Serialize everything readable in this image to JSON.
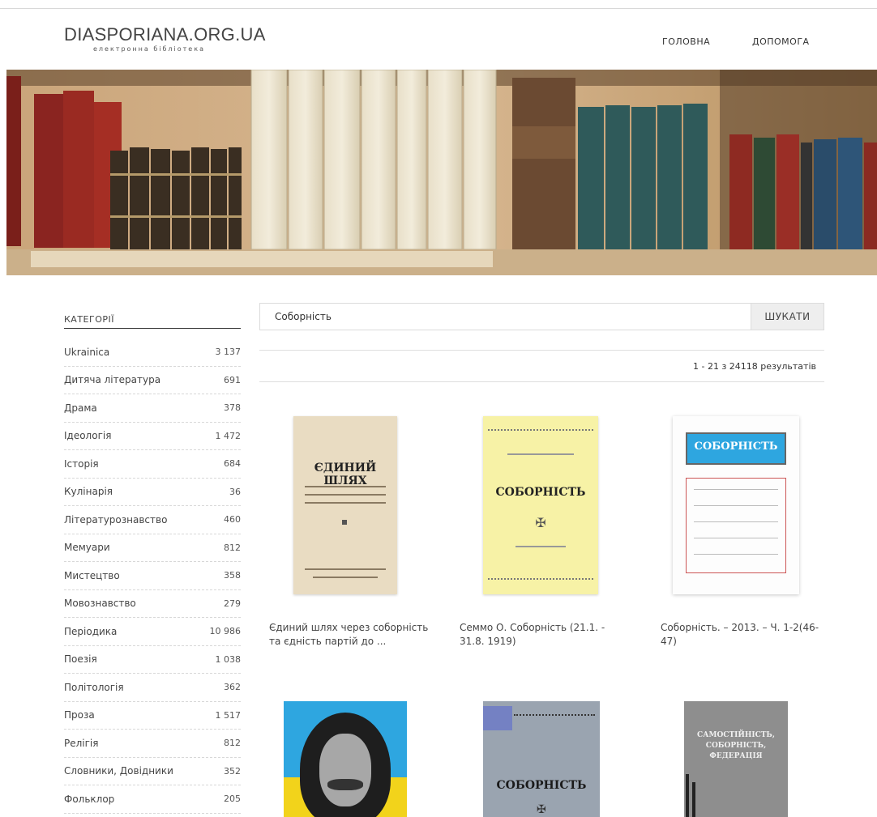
{
  "header": {
    "site_title": "DIASPORIANA.ORG.UA",
    "site_subtitle": "електронна бібліотека",
    "nav": [
      "ГОЛОВНА",
      "ДОПОМОГА"
    ]
  },
  "sidebar": {
    "title": "КАТЕГОРІЇ",
    "categories": [
      {
        "label": "Ukrainica",
        "count": "3 137"
      },
      {
        "label": "Дитяча література",
        "count": "691"
      },
      {
        "label": "Драма",
        "count": "378"
      },
      {
        "label": "Ідеологія",
        "count": "1 472"
      },
      {
        "label": "Історія",
        "count": "684"
      },
      {
        "label": "Кулінарія",
        "count": "36"
      },
      {
        "label": "Літературознавство",
        "count": "460"
      },
      {
        "label": "Мемуари",
        "count": "812"
      },
      {
        "label": "Мистецтво",
        "count": "358"
      },
      {
        "label": "Мовознавство",
        "count": "279"
      },
      {
        "label": "Періодика",
        "count": "10 986"
      },
      {
        "label": "Поезія",
        "count": "1 038"
      },
      {
        "label": "Політологія",
        "count": "362"
      },
      {
        "label": "Проза",
        "count": "1 517"
      },
      {
        "label": "Релігія",
        "count": "812"
      },
      {
        "label": "Словники, Довідники",
        "count": "352"
      },
      {
        "label": "Фольклор",
        "count": "205"
      }
    ]
  },
  "search": {
    "value": "Соборність",
    "button_label": "ШУКАТИ"
  },
  "results_info": "1 - 21 з 24118 результатів",
  "books": [
    {
      "title": "Єдиний шлях через соборність та єдність партій до ...",
      "cover_text": "ЄДИНИЙ ШЛЯХ"
    },
    {
      "title": "Семмо О. Соборність (21.1. - 31.8. 1919)",
      "cover_text": "СОБОРНІСТЬ"
    },
    {
      "title": "Соборність. – 2013. – Ч. 1-2(46-47)",
      "cover_text": "СОБОРНІСТЬ"
    },
    {
      "title": "",
      "cover_text": ""
    },
    {
      "title": "",
      "cover_text": "СОБОРНІСТЬ"
    },
    {
      "title": "",
      "cover_text": "САМОСТІЙНІСТЬ, СОБОРНІСТЬ, ФЕДЕРАЦІЯ"
    }
  ],
  "colors": {
    "cover_yellow": "#f7f2a6",
    "cover_beige": "#e9dcc2",
    "cover_blue": "#2ea6e0",
    "cover_yellow_flag": "#f2d31b"
  }
}
